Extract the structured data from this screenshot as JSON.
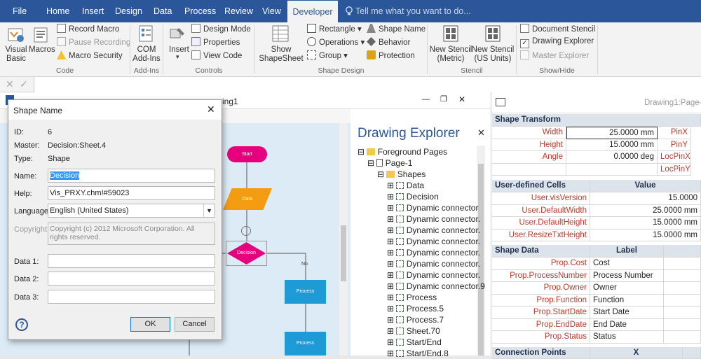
{
  "tabs": [
    "File",
    "Home",
    "Insert",
    "Design",
    "Data",
    "Process",
    "Review",
    "View",
    "Developer"
  ],
  "tell_me": "Tell me what you want to do...",
  "ribbon": {
    "code": {
      "visual_basic": "Visual Basic",
      "macros": "Macros",
      "record_macro": "Record Macro",
      "pause_recording": "Pause Recording",
      "macro_security": "Macro Security",
      "label": "Code"
    },
    "addins": {
      "com_addins": "COM Add-Ins",
      "label": "Add-Ins"
    },
    "controls": {
      "insert": "Insert",
      "design_mode": "Design Mode",
      "properties": "Properties",
      "view_code": "View Code",
      "label": "Controls"
    },
    "shape_design": {
      "show_shapesheet": "Show ShapeSheet",
      "rectangle": "Rectangle",
      "operations": "Operations",
      "group": "Group",
      "shape_name": "Shape Name",
      "behavior": "Behavior",
      "protection": "Protection",
      "label": "Shape Design"
    },
    "stencil": {
      "new_metric": "New Stencil (Metric)",
      "new_us": "New Stencil (US Units)",
      "label": "Stencil"
    },
    "show_hide": {
      "document_stencil": "Document Stencil",
      "drawing_explorer": "Drawing Explorer",
      "master_explorer": "Master Explorer",
      "label": "Show/Hide",
      "drawing_explorer_checked": true
    }
  },
  "doc_title_fragment": "ing1",
  "shapesheet_title": "Drawing1:Page-",
  "flowchart": {
    "start": "Start",
    "data": "Data",
    "decision": "Decision",
    "no": "No",
    "process1": "Process",
    "process2": "Process"
  },
  "explorer": {
    "title": "Drawing Explorer",
    "items": [
      "Foreground Pages",
      "Page-1",
      "Shapes",
      "Data",
      "Decision",
      "Dynamic connector",
      "Dynamic connector.",
      "Dynamic connector.",
      "Dynamic connector.",
      "Dynamic connector.",
      "Dynamic connector.",
      "Dynamic connector.",
      "Dynamic connector.9",
      "Process",
      "Process.5",
      "Process.7",
      "Sheet.70",
      "Start/End",
      "Start/End.8"
    ]
  },
  "shapesheet": {
    "transform": {
      "header": "Shape Transform",
      "rows": [
        [
          "Width",
          "25.0000 mm",
          "PinX"
        ],
        [
          "Height",
          "15.0000 mm",
          "PinY"
        ],
        [
          "Angle",
          "0.0000 deg",
          "LocPinX"
        ],
        [
          "",
          "",
          "LocPinY"
        ]
      ]
    },
    "user": {
      "header": "User-defined Cells",
      "value_header": "Value",
      "rows": [
        [
          "User.visVersion",
          "15.0000"
        ],
        [
          "User.DefaultWidth",
          "25.0000 mm"
        ],
        [
          "User.DefaultHeight",
          "15.0000 mm"
        ],
        [
          "User.ResizeTxtHeight",
          "15.0000 mm"
        ]
      ]
    },
    "shape_data": {
      "header": "Shape Data",
      "label_header": "Label",
      "rows": [
        [
          "Prop.Cost",
          "Cost"
        ],
        [
          "Prop.ProcessNumber",
          "Process Number"
        ],
        [
          "Prop.Owner",
          "Owner"
        ],
        [
          "Prop.Function",
          "Function"
        ],
        [
          "Prop.StartDate",
          "Start Date"
        ],
        [
          "Prop.EndDate",
          "End Date"
        ],
        [
          "Prop.Status",
          "Status"
        ]
      ]
    },
    "connection": {
      "header": "Connection Points",
      "x_header": "X"
    }
  },
  "dialog": {
    "title": "Shape Name",
    "id_label": "ID:",
    "id_value": "6",
    "master_label": "Master:",
    "master_value": "Decision:Sheet.4",
    "type_label": "Type:",
    "type_value": "Shape",
    "name_label": "Name:",
    "name_value": "Decision",
    "help_label": "Help:",
    "help_value": "Vis_PRXY.chm!#59023",
    "language_label": "Language:",
    "language_value": "English (United States)",
    "copyright_label": "Copyright:",
    "copyright_value": "Copyright (c) 2012 Microsoft Corporation.  All rights reserved.",
    "data1_label": "Data 1:",
    "data2_label": "Data 2:",
    "data3_label": "Data 3:",
    "ok": "OK",
    "cancel": "Cancel"
  },
  "colors": {
    "ribbon_blue": "#2b579a",
    "terminator": "#e6007e",
    "data": "#f39c12",
    "decision": "#e6007e",
    "process": "#1e9ad6"
  }
}
